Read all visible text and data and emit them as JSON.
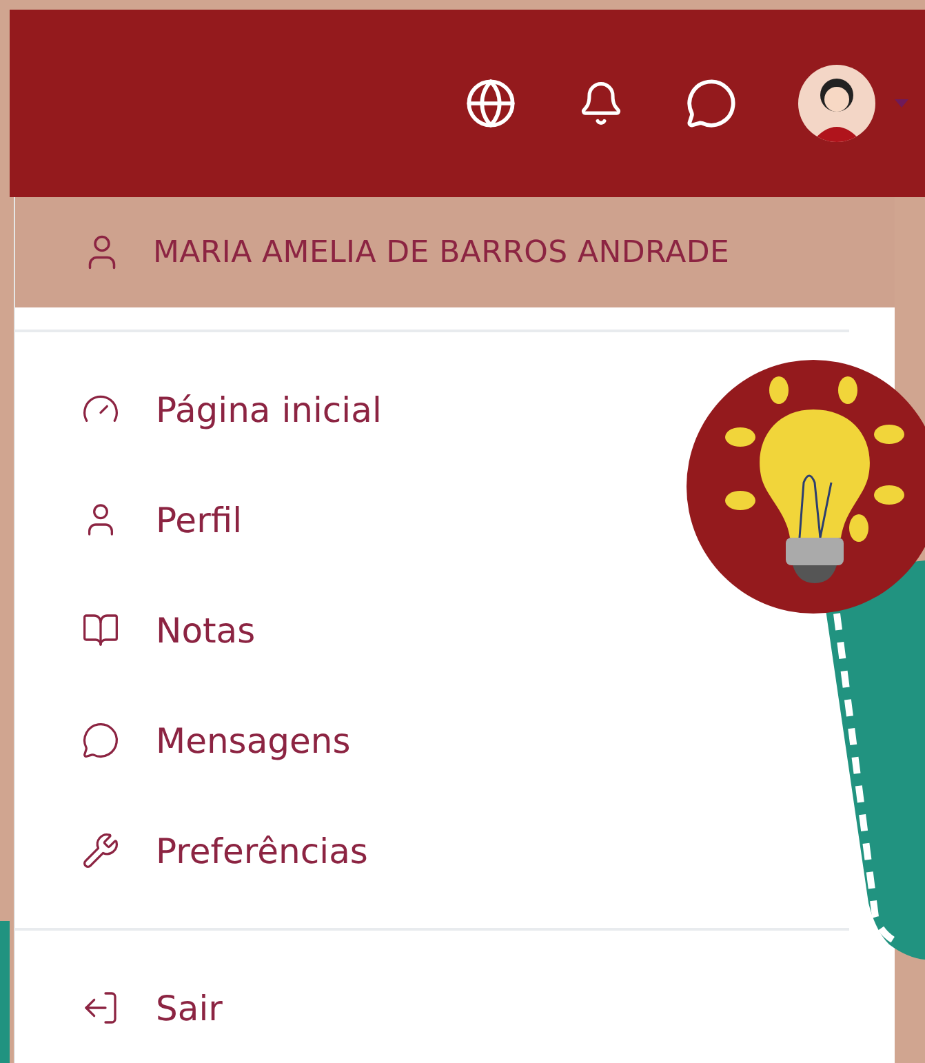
{
  "user_menu": {
    "name": "MARIA AMELIA DE BARROS ANDRADE",
    "sections": [
      [
        {
          "label": "Página inicial"
        },
        {
          "label": "Perfil"
        },
        {
          "label": "Notas"
        },
        {
          "label": "Mensagens"
        },
        {
          "label": "Preferências"
        }
      ],
      [
        {
          "label": "Sair"
        }
      ]
    ]
  }
}
